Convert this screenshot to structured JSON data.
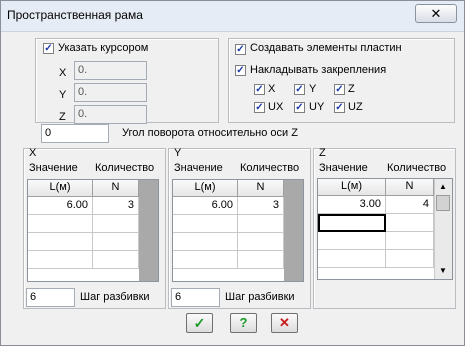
{
  "window": {
    "title": "Пространственная рама",
    "close_glyph": "✕"
  },
  "cursor_group": {
    "checkbox_label": "Указать курсором",
    "x_label": "X",
    "x_value": "0.",
    "y_label": "Y",
    "y_value": "0.",
    "z_label": "Z",
    "z_value": "0."
  },
  "options": {
    "create_plates_label": "Создавать элементы пластин",
    "apply_supports_label": "Накладывать закрепления",
    "x": "X",
    "y": "Y",
    "z": "Z",
    "ux": "UX",
    "uy": "UY",
    "uz": "UZ"
  },
  "rotation": {
    "value": "0",
    "label": "Угол поворота относительно оси Z"
  },
  "axes": [
    {
      "title": "X",
      "col_value": "Значение",
      "col_count": "Количество",
      "head_l": "L(м)",
      "head_n": "N",
      "rows": [
        {
          "l": "6.00",
          "n": "3"
        }
      ],
      "step_value": "6",
      "step_label": "Шаг разбивки"
    },
    {
      "title": "Y",
      "col_value": "Значение",
      "col_count": "Количество",
      "head_l": "L(м)",
      "head_n": "N",
      "rows": [
        {
          "l": "6.00",
          "n": "3"
        }
      ],
      "step_value": "6",
      "step_label": "Шаг разбивки"
    },
    {
      "title": "Z",
      "col_value": "Значение",
      "col_count": "Количество",
      "head_l": "L(м)",
      "head_n": "N",
      "rows": [
        {
          "l": "3.00",
          "n": "4"
        }
      ]
    }
  ],
  "buttons": {
    "ok": "✓",
    "help": "?",
    "cancel": "✕"
  },
  "colors": {
    "ok": "#1b9a2a",
    "help": "#1b9a2a",
    "cancel": "#c81c1c",
    "check": "#1a3aa8"
  }
}
